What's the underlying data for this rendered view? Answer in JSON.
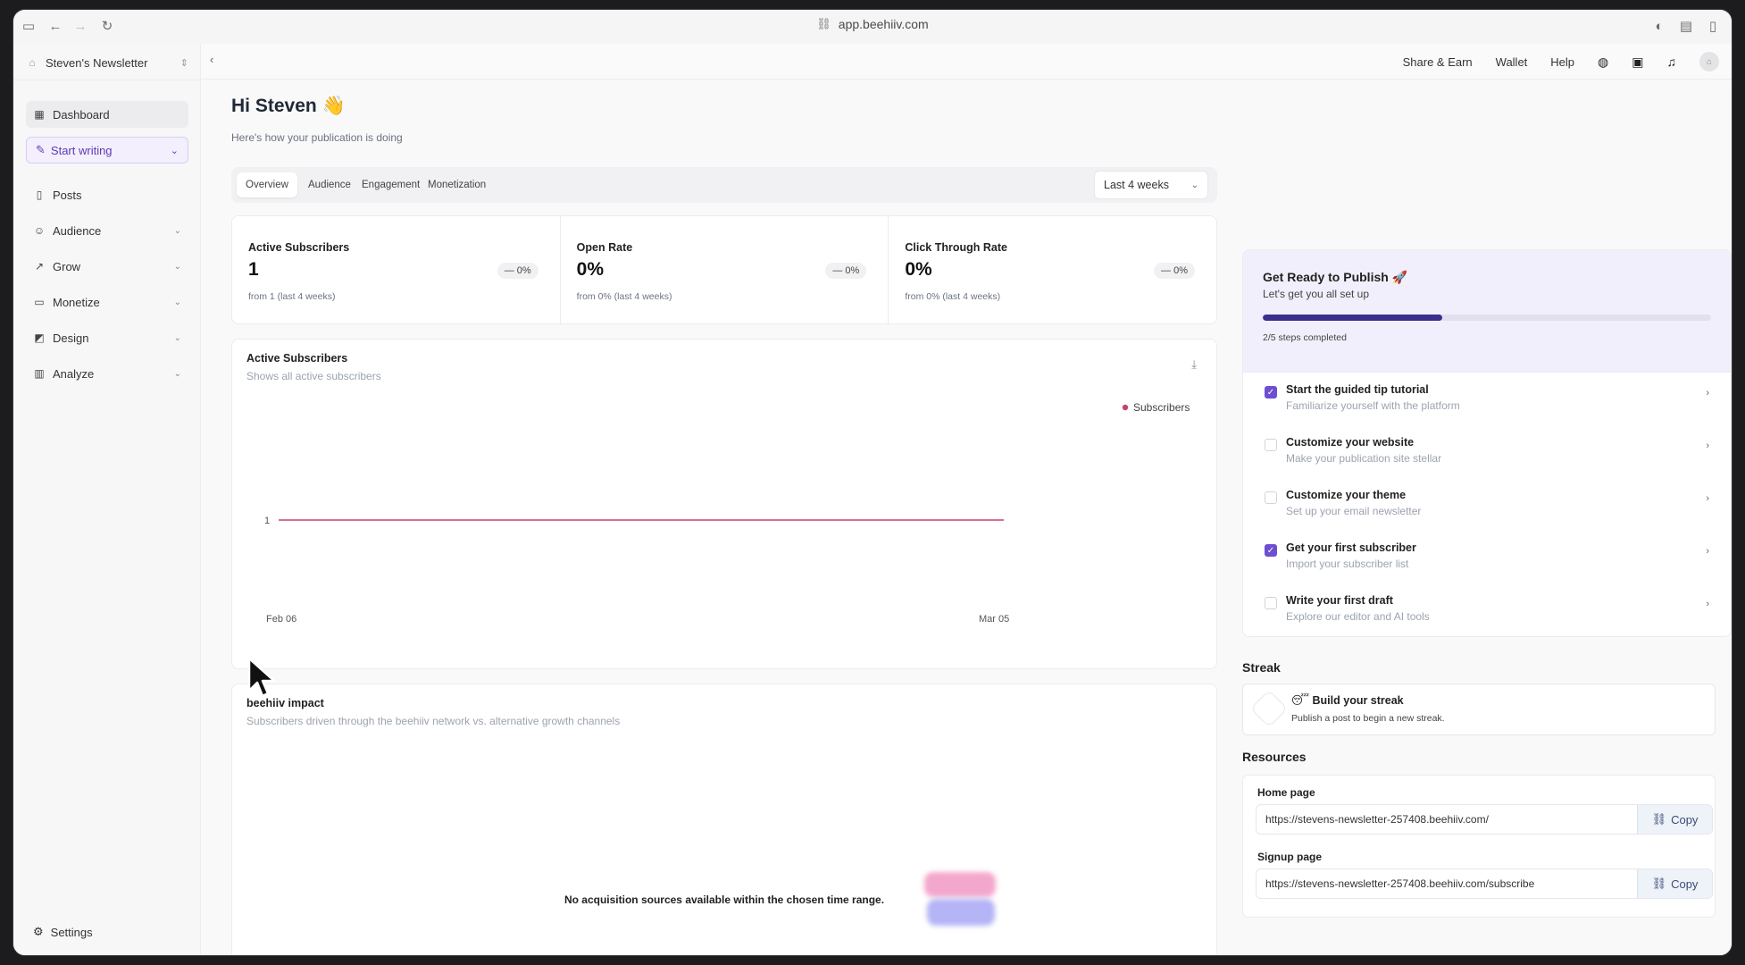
{
  "browser": {
    "url": "app.beehiiv.com"
  },
  "sidebar": {
    "publication": "Steven's Newsletter",
    "dashboard_label": "Dashboard",
    "start_writing_label": "Start writing",
    "items": [
      {
        "label": "Posts",
        "icon": "document-icon",
        "has_chevron": false
      },
      {
        "label": "Audience",
        "icon": "users-icon",
        "has_chevron": true
      },
      {
        "label": "Grow",
        "icon": "trend-up-icon",
        "has_chevron": true
      },
      {
        "label": "Monetize",
        "icon": "money-icon",
        "has_chevron": true
      },
      {
        "label": "Design",
        "icon": "palette-icon",
        "has_chevron": true
      },
      {
        "label": "Analyze",
        "icon": "bar-chart-icon",
        "has_chevron": true
      }
    ],
    "settings_label": "Settings"
  },
  "topnav": {
    "share_earn": "Share & Earn",
    "wallet": "Wallet",
    "help": "Help"
  },
  "greeting": {
    "title": "Hi Steven 👋",
    "subtitle": "Here's how your publication is doing"
  },
  "tabs": {
    "overview": "Overview",
    "audience": "Audience",
    "engagement": "Engagement",
    "monetization": "Monetization",
    "range": "Last 4 weeks"
  },
  "metrics": [
    {
      "label": "Active Subscribers",
      "value": "1",
      "delta": "— 0%",
      "from": "from 1 (last 4 weeks)"
    },
    {
      "label": "Open Rate",
      "value": "0%",
      "delta": "— 0%",
      "from": "from 0% (last 4 weeks)"
    },
    {
      "label": "Click Through Rate",
      "value": "0%",
      "delta": "— 0%",
      "from": "from 0% (last 4 weeks)"
    }
  ],
  "subscriber_chart": {
    "title": "Active Subscribers",
    "subtitle": "Shows all active subscribers"
  },
  "chart_data": {
    "type": "line",
    "x": [
      "Feb 06",
      "Mar 05"
    ],
    "series": [
      {
        "name": "Subscribers",
        "values": [
          1,
          1
        ],
        "color": "#c7426f"
      }
    ],
    "y_ticks": [
      "1"
    ],
    "legend_position": "top-right",
    "grid": false
  },
  "impact": {
    "title": "beehiiv impact",
    "subtitle": "Subscribers driven through the beehiiv network vs. alternative growth channels",
    "empty_message": "No acquisition sources available within the chosen time range."
  },
  "publish": {
    "title": "Get Ready to Publish 🚀",
    "subtitle": "Let's get you all set up",
    "progress_fraction": 0.4,
    "steps_completed": "2/5 steps completed",
    "steps": [
      {
        "title": "Start the guided tip tutorial",
        "subtitle": "Familiarize yourself with the platform",
        "checked": true
      },
      {
        "title": "Customize your website",
        "subtitle": "Make your publication site stellar",
        "checked": false
      },
      {
        "title": "Customize your theme",
        "subtitle": "Set up your email newsletter",
        "checked": false
      },
      {
        "title": "Get your first subscriber",
        "subtitle": "Import your subscriber list",
        "checked": true
      },
      {
        "title": "Write your first draft",
        "subtitle": "Explore our editor and AI tools",
        "checked": false
      }
    ]
  },
  "streak": {
    "heading": "Streak",
    "title": "😴 Build your streak",
    "subtitle": "Publish a post to begin a new streak."
  },
  "resources": {
    "heading": "Resources",
    "home_label": "Home page",
    "home_url": "https://stevens-newsletter-257408.beehiiv.com/",
    "signup_label": "Signup page",
    "signup_url": "https://stevens-newsletter-257408.beehiiv.com/subscribe",
    "copy_label": "Copy"
  },
  "colors": {
    "accent": "#6d4fd1",
    "progress": "#3b2f8c",
    "series": "#c7426f"
  }
}
